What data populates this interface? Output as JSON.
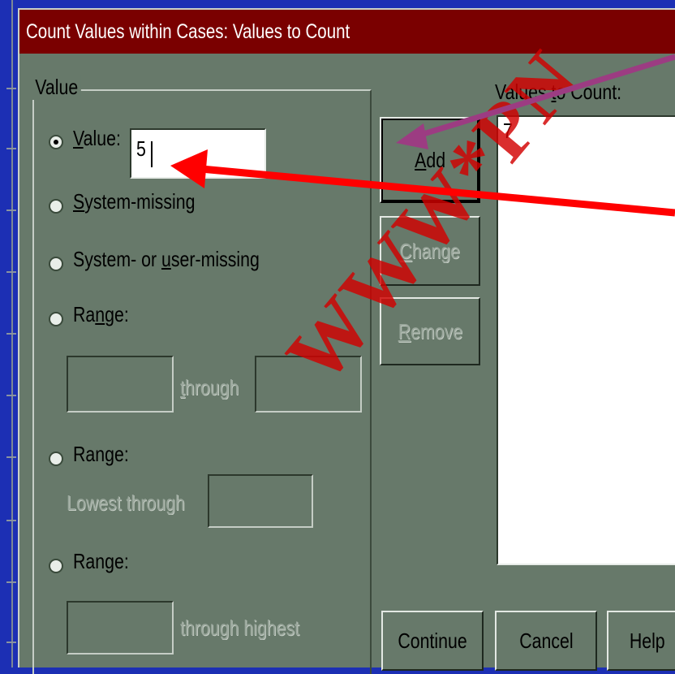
{
  "window": {
    "title": "Count Values within Cases: Values to Count"
  },
  "value_group": {
    "label": "Value",
    "value_label": "Value:",
    "value_input": "5",
    "system_missing": "System-missing",
    "system_or_user_missing": "System- or user-missing",
    "range_label": "Range:",
    "through": "through",
    "range2_label": "Range:",
    "lowest_through": "Lowest through",
    "range3_label": "Range:",
    "through_highest": "through highest"
  },
  "buttons": {
    "add": "Add",
    "change": "Change",
    "remove": "Remove",
    "continue": "Continue",
    "cancel": "Cancel",
    "help": "Help"
  },
  "values_list": {
    "label": "Values to Count:",
    "items": [
      "7"
    ]
  },
  "watermark": "WWW*PN",
  "colors": {
    "title_bar": "#7a0000",
    "dialog": "#67796a",
    "arrow_red": "#ff0000",
    "arrow_purple": "#9c3c82"
  }
}
